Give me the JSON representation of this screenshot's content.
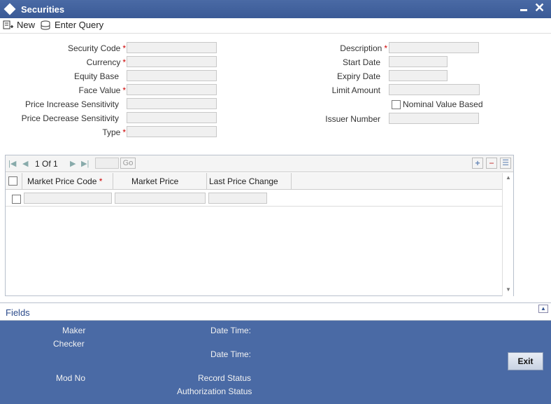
{
  "window": {
    "title": "Securities"
  },
  "toolbar": {
    "new_label": "New",
    "enter_query_label": "Enter Query"
  },
  "form": {
    "security_code_label": "Security Code",
    "currency_label": "Currency",
    "equity_base_label": "Equity Base",
    "face_value_label": "Face Value",
    "price_increase_label": "Price Increase Sensitivity",
    "price_decrease_label": "Price Decrease Sensitivity",
    "type_label": "Type",
    "description_label": "Description",
    "start_date_label": "Start Date",
    "expiry_date_label": "Expiry Date",
    "limit_amount_label": "Limit Amount",
    "nominal_value_label": "Nominal Value Based",
    "issuer_number_label": "Issuer Number",
    "required_mark": "*"
  },
  "grid": {
    "page_current": "1",
    "page_of": "Of",
    "page_total": "1",
    "go_label": "Go",
    "columns": [
      "Market Price Code",
      "Market Price",
      "Last Price Change"
    ]
  },
  "fields": {
    "label": "Fields"
  },
  "footer": {
    "maker_label": "Maker",
    "checker_label": "Checker",
    "date_time_label": "Date Time:",
    "mod_no_label": "Mod No",
    "record_status_label": "Record Status",
    "authorization_status_label": "Authorization Status",
    "exit_label": "Exit"
  }
}
